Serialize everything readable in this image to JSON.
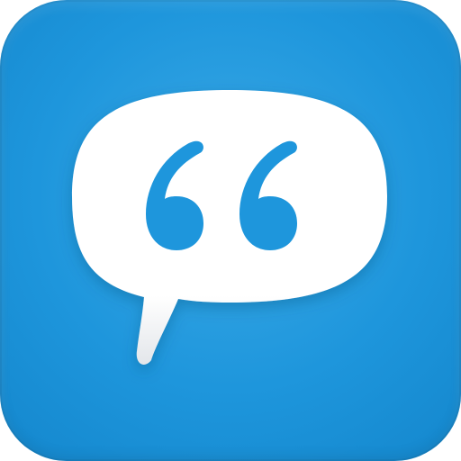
{
  "app_icon": {
    "name": "speech-bubble-quote-app",
    "colors": {
      "tile_top": "#3aa9e6",
      "tile_mid": "#1e96dc",
      "tile_bottom": "#1487cd",
      "bubble": "#ffffff",
      "bubble_shade": "#d8dde3",
      "quote_marks": "#1e96dc"
    },
    "icons": {
      "bubble": "speech-bubble-icon",
      "quotes": "quote-marks-icon"
    }
  }
}
